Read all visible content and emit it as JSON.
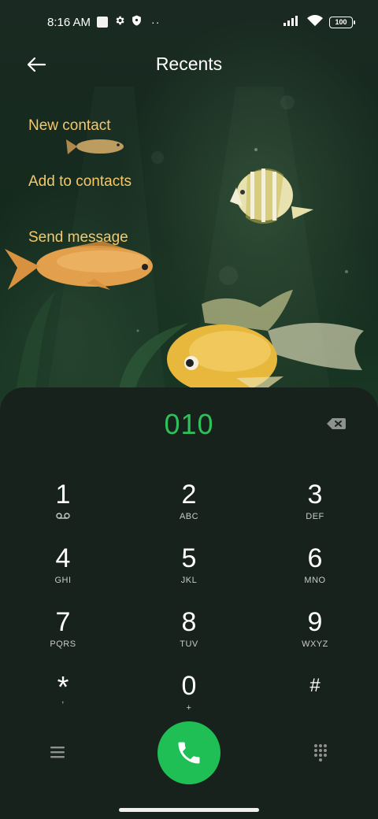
{
  "status_bar": {
    "time": "8:16 AM",
    "battery": "100",
    "icons": [
      "notification-square-icon",
      "gear-icon",
      "shield-icon",
      "more-dots-icon",
      "signal-icon",
      "wifi-icon",
      "battery-icon"
    ]
  },
  "header": {
    "title": "Recents",
    "back_icon": "back-arrow-icon"
  },
  "actions": {
    "new_contact": "New contact",
    "add_to_contacts": "Add to contacts",
    "send_message": "Send message"
  },
  "dialer": {
    "number": "010",
    "keys": [
      {
        "digit": "1",
        "letters": ""
      },
      {
        "digit": "2",
        "letters": "ABC"
      },
      {
        "digit": "3",
        "letters": "DEF"
      },
      {
        "digit": "4",
        "letters": "GHI"
      },
      {
        "digit": "5",
        "letters": "JKL"
      },
      {
        "digit": "6",
        "letters": "MNO"
      },
      {
        "digit": "7",
        "letters": "PQRS"
      },
      {
        "digit": "8",
        "letters": "TUV"
      },
      {
        "digit": "9",
        "letters": "WXYZ"
      },
      {
        "digit": "*",
        "letters": ","
      },
      {
        "digit": "0",
        "letters": "+"
      },
      {
        "digit": "#",
        "letters": ""
      }
    ]
  },
  "colors": {
    "accent_green": "#1fbf55",
    "number_green": "#2ec15a",
    "action_yellow": "#f5c869",
    "panel_bg": "#18221c"
  }
}
